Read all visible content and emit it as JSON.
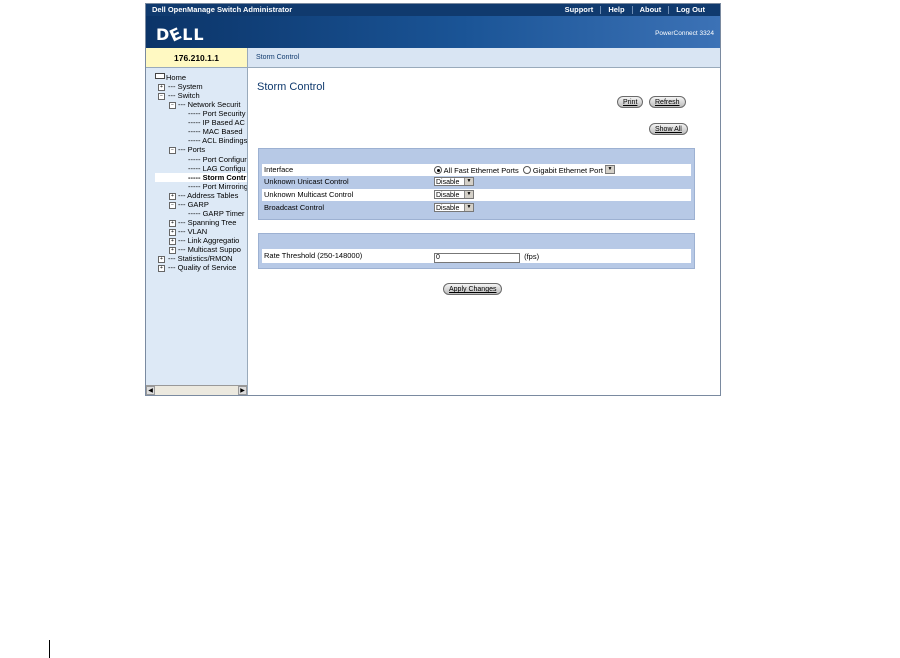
{
  "header": {
    "app_title": "Dell OpenManage Switch Administrator",
    "menu": [
      "Support",
      "Help",
      "About",
      "Log Out"
    ],
    "logo": "D",
    "logo_e": "E",
    "logo_rest": "LL",
    "product": "PowerConnect 3324"
  },
  "ip_address": "176.210.1.1",
  "breadcrumb": "Storm Control",
  "tree": [
    {
      "label": "Home"
    },
    {
      "label": "System"
    },
    {
      "label": "Switch"
    },
    {
      "label": "Network Securit"
    },
    {
      "label": "Port Security"
    },
    {
      "label": "IP Based AC"
    },
    {
      "label": "MAC Based"
    },
    {
      "label": "ACL Bindings"
    },
    {
      "label": "Ports"
    },
    {
      "label": "Port Configur"
    },
    {
      "label": "LAG Configu"
    },
    {
      "label": "Storm Contr"
    },
    {
      "label": "Port Mirroring"
    },
    {
      "label": "Address Tables"
    },
    {
      "label": "GARP"
    },
    {
      "label": "GARP Timer"
    },
    {
      "label": "Spanning Tree"
    },
    {
      "label": "VLAN"
    },
    {
      "label": "Link Aggregatio"
    },
    {
      "label": "Multicast Suppo"
    },
    {
      "label": "Statistics/RMON"
    },
    {
      "label": "Quality of Service"
    }
  ],
  "page": {
    "title": "Storm Control",
    "print_label": "Print",
    "refresh_label": "Refresh",
    "show_all_label": "Show All",
    "apply_label": "Apply Changes"
  },
  "form": {
    "interface_label": "Interface",
    "radio_fast": "All Fast Ethernet Ports",
    "radio_gig": "Gigabit Ethernet Port",
    "unicast_label": "Unknown Unicast Control",
    "unicast_value": "Disable",
    "multicast_label": "Unknown Multicast Control",
    "multicast_value": "Disable",
    "broadcast_label": "Broadcast Control",
    "broadcast_value": "Disable",
    "rate_label": "Rate Threshold (250-148000)",
    "rate_value": "0",
    "rate_unit": "(fps)"
  }
}
